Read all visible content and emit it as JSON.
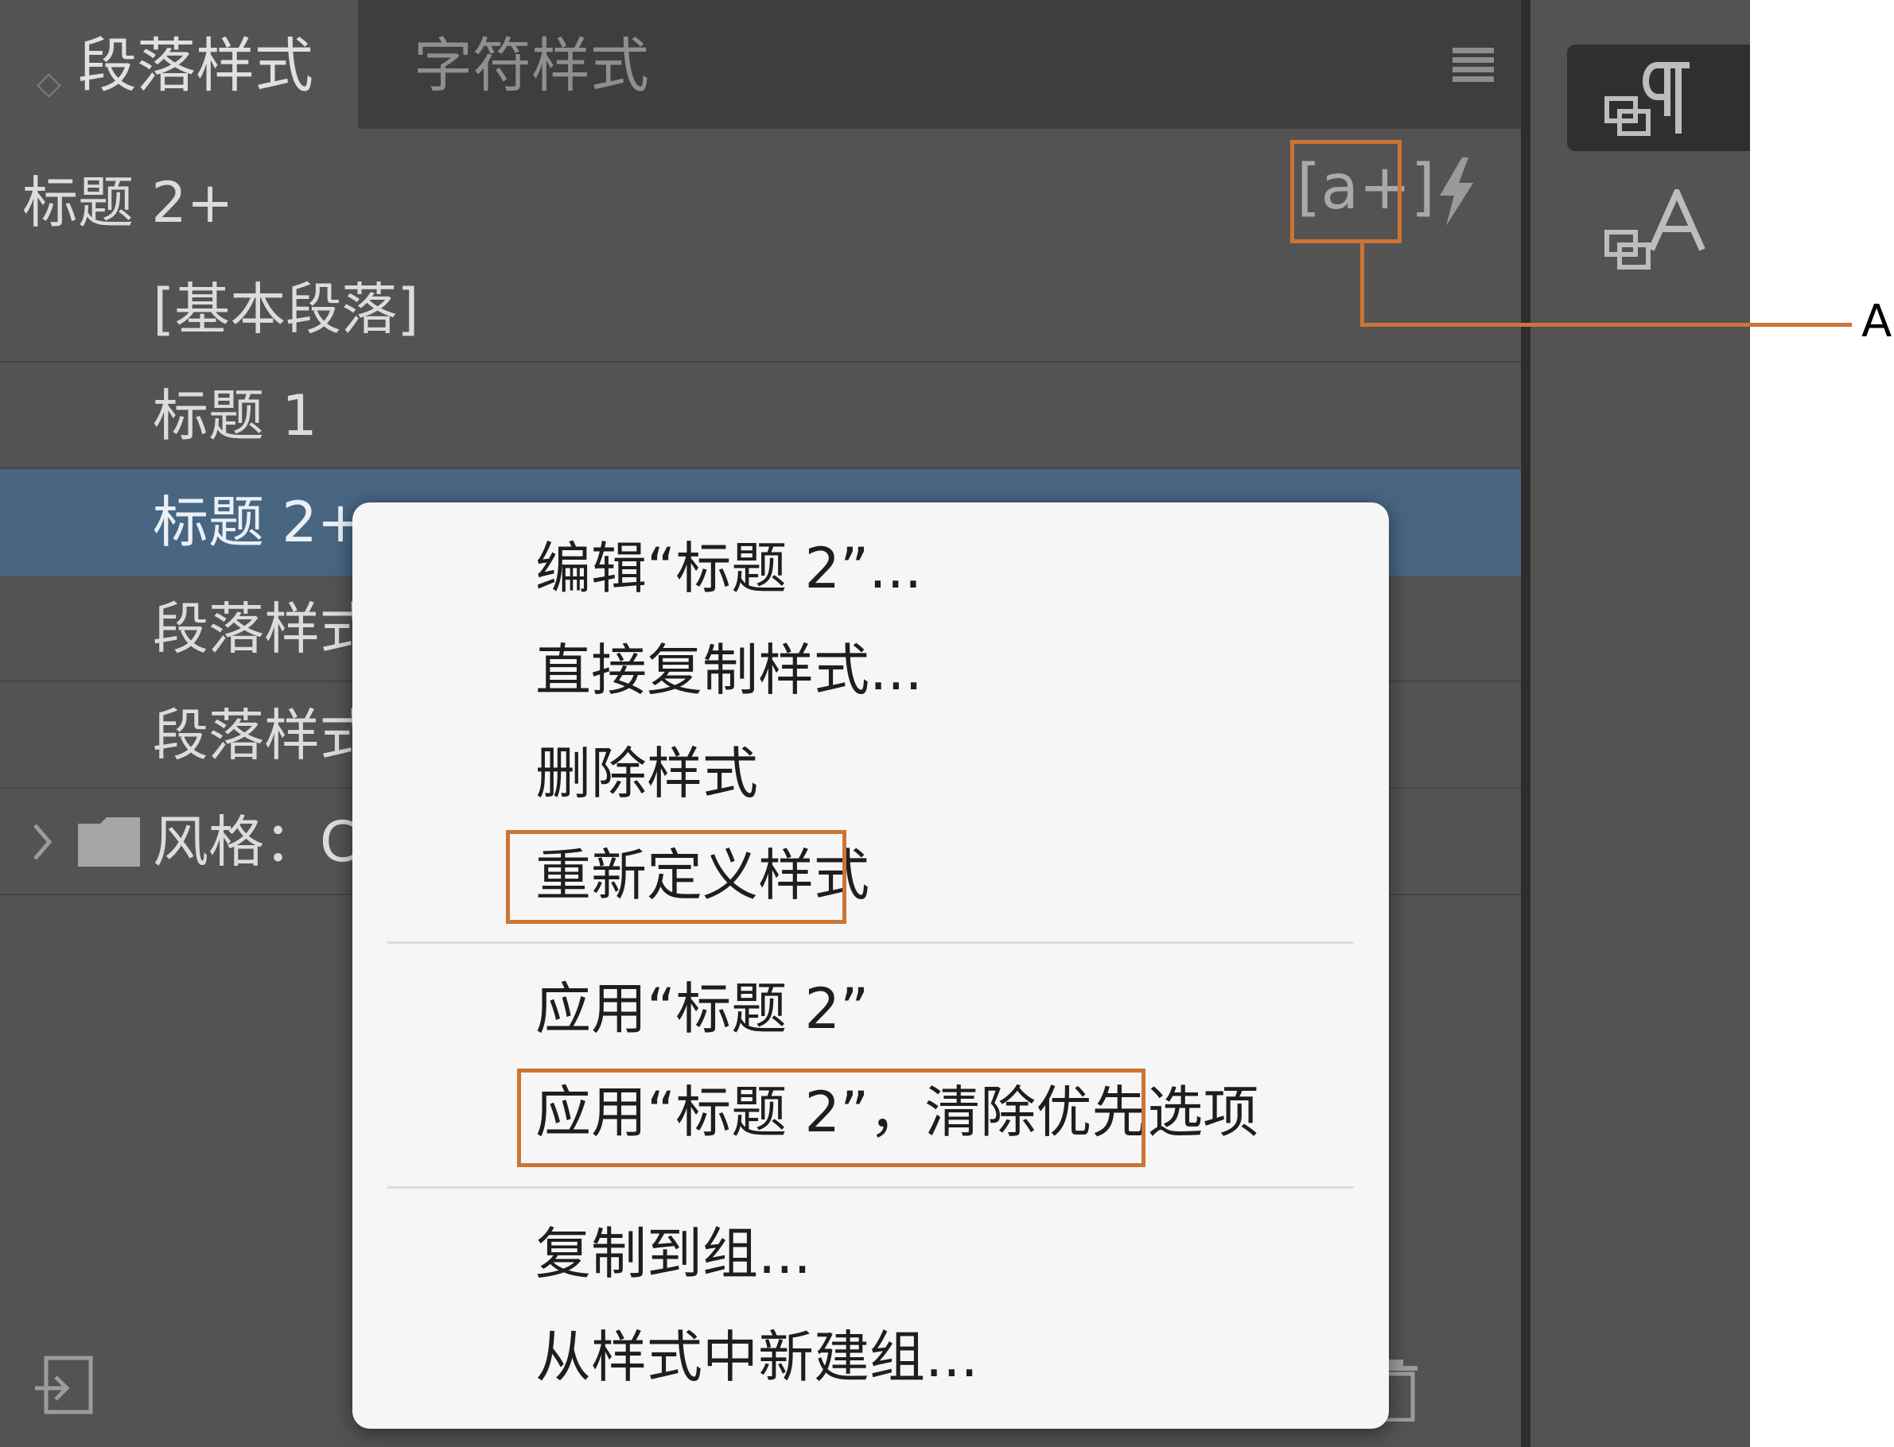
{
  "tabs": [
    {
      "label": "段落样式",
      "active": true
    },
    {
      "label": "字符样式",
      "active": false
    }
  ],
  "tab_toggle_glyph": "◇",
  "current_style": "标题 2+",
  "new_style_button": "[a+]",
  "style_list": [
    {
      "label": "[基本段落]",
      "selected": false
    },
    {
      "label": "标题 1",
      "selected": false
    },
    {
      "label": "标题 2+",
      "selected": true
    },
    {
      "label": "段落样式",
      "selected": false
    },
    {
      "label": "段落样式",
      "selected": false
    }
  ],
  "folder_row": {
    "label": "风格：Ce"
  },
  "context_menu": {
    "group1": [
      "编辑“标题 2”...",
      "直接复制样式...",
      "删除样式",
      "重新定义样式"
    ],
    "group2": [
      "应用“标题 2”",
      "应用“标题 2”，清除优先选项"
    ],
    "group3": [
      "复制到组...",
      "从样式中新建组..."
    ]
  },
  "callout": {
    "label": "A"
  },
  "colors": {
    "panel_bg": "#535353",
    "tabbar_bg": "#3e3e3e",
    "selected_row": "#486582",
    "menu_bg": "#f6f6f6",
    "highlight": "#cc7433"
  },
  "icons": [
    "chevron-right-icon",
    "folder-icon",
    "lightning-icon",
    "panel-menu-icon",
    "paragraph-styles-icon",
    "character-styles-icon",
    "load-styles-icon",
    "trash-icon"
  ]
}
